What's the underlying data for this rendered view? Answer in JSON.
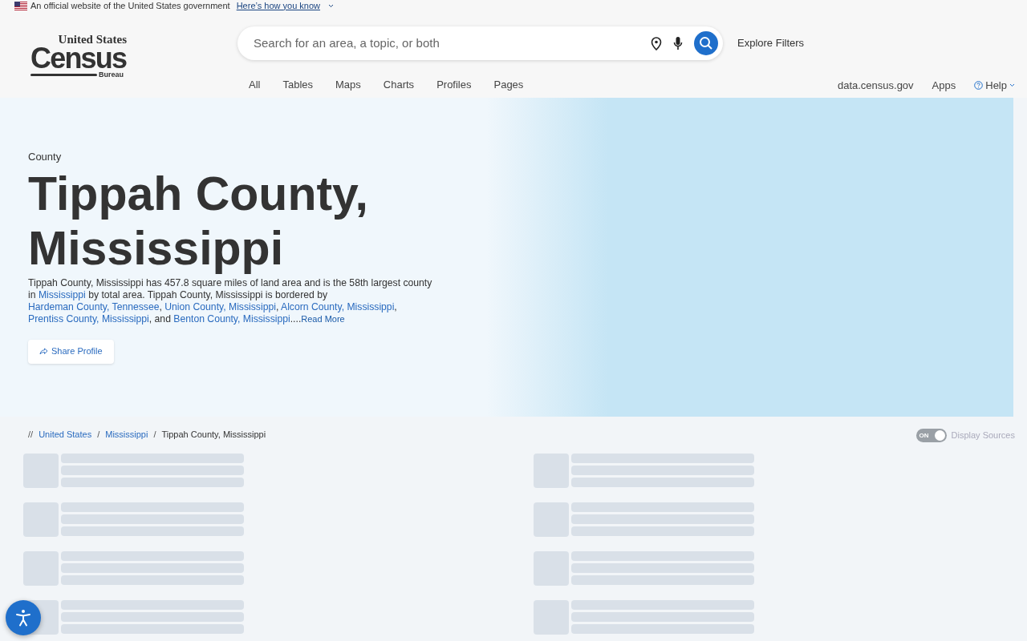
{
  "gov_banner": {
    "text": "An official website of the United States government",
    "link": "Here’s how you know"
  },
  "logo": {
    "top": "United States",
    "main": "Census",
    "bottom": "Bureau"
  },
  "search": {
    "placeholder": "Search for an area, a topic, or both",
    "filters": "Explore Filters"
  },
  "search_tabs": [
    "All",
    "Tables",
    "Maps",
    "Charts",
    "Profiles",
    "Pages"
  ],
  "header_links": [
    {
      "label": "data.census.gov",
      "kind": "link"
    },
    {
      "label": "Apps",
      "kind": "link"
    },
    {
      "label": "Help",
      "kind": "menu"
    }
  ],
  "hero": {
    "eyebrow": "County",
    "title": "Tippah County, Mississippi",
    "description": [
      {
        "kind": "text",
        "text": "Tippah County, Mississippi has 457.8 square miles of land area and is the 58th largest county in "
      },
      {
        "kind": "link",
        "text": "Mississippi"
      },
      {
        "kind": "text",
        "text": " by total area. Tippah County, Mississippi is bordered by "
      },
      {
        "kind": "link",
        "text": "Hardeman County, Tennessee"
      },
      {
        "kind": "text",
        "text": ", "
      },
      {
        "kind": "link",
        "text": "Union County, Mississippi"
      },
      {
        "kind": "text",
        "text": ", "
      },
      {
        "kind": "link",
        "text": "Alcorn County, Mississippi"
      },
      {
        "kind": "text",
        "text": ", "
      },
      {
        "kind": "link",
        "text": "Prentiss County, Mississippi"
      },
      {
        "kind": "text",
        "text": ", and "
      },
      {
        "kind": "link",
        "text": "Benton County, Mississippi"
      },
      {
        "kind": "text",
        "text": "...."
      },
      {
        "kind": "more",
        "text": "Read More"
      }
    ],
    "share": "Share Profile"
  },
  "breadcrumb": {
    "prefix": "//",
    "items": [
      {
        "label": "United States",
        "kind": "link"
      },
      {
        "label": "Mississippi",
        "kind": "link"
      },
      {
        "label": "Tippah County, Mississippi",
        "kind": "current"
      }
    ],
    "separator": "/"
  },
  "display_sources": {
    "label": "Display Sources",
    "switch_text": "ON",
    "on": true
  }
}
